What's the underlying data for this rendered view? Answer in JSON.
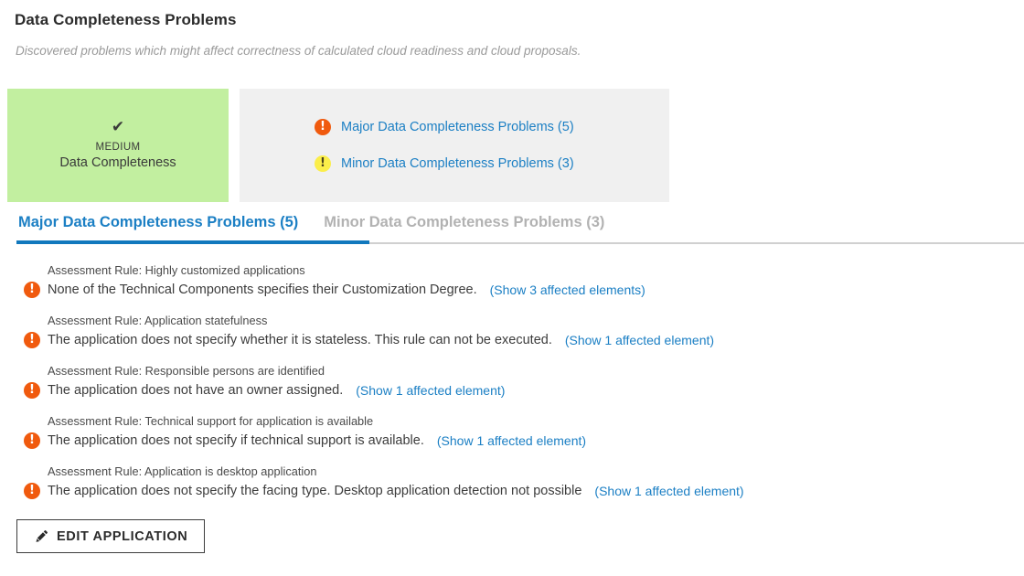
{
  "header": {
    "title": "Data Completeness Problems",
    "subtitle": "Discovered problems which might affect correctness of calculated cloud readiness and cloud proposals."
  },
  "score_card": {
    "icon": "check-icon",
    "check_glyph": "✔",
    "level": "MEDIUM",
    "label": "Data Completeness",
    "background_color": "#c2efa0"
  },
  "problems_summary": {
    "background_color": "#f0f0f0",
    "items": [
      {
        "icon": "alert-major-icon",
        "glyph": "!",
        "severity": "major",
        "label": "Major Data Completeness Problems (5)",
        "color": "#f05a0e"
      },
      {
        "icon": "alert-minor-icon",
        "glyph": "!",
        "severity": "minor",
        "label": "Minor Data Completeness Problems (3)",
        "color": "#fbee4a"
      }
    ]
  },
  "tabs": {
    "active_index": 0,
    "accent_color": "#1178bd",
    "items": [
      {
        "label": "Major Data Completeness Problems (5)"
      },
      {
        "label": "Minor Data Completeness Problems (3)"
      }
    ]
  },
  "problem_list": [
    {
      "rule": "Assessment Rule: Highly customized applications",
      "glyph": "!",
      "message": "None of the Technical Components specifies their Customization Degree.",
      "link": "(Show 3 affected elements)"
    },
    {
      "rule": "Assessment Rule: Application statefulness",
      "glyph": "!",
      "message": "The application does not specify whether it is stateless. This rule can not be executed.",
      "link": "(Show 1 affected element)"
    },
    {
      "rule": "Assessment Rule: Responsible persons are identified",
      "glyph": "!",
      "message": "The application does not have an owner assigned.",
      "link": "(Show 1 affected element)"
    },
    {
      "rule": "Assessment Rule: Technical support for application is available",
      "glyph": "!",
      "message": "The application does not specify if technical support is available.",
      "link": "(Show 1 affected element)"
    },
    {
      "rule": "Assessment Rule: Application is desktop application",
      "glyph": "!",
      "message": "The application does not specify the facing type. Desktop application detection not possible",
      "link": "(Show 1 affected element)"
    }
  ],
  "edit_button": {
    "icon": "pencil-icon",
    "label": "EDIT APPLICATION"
  }
}
